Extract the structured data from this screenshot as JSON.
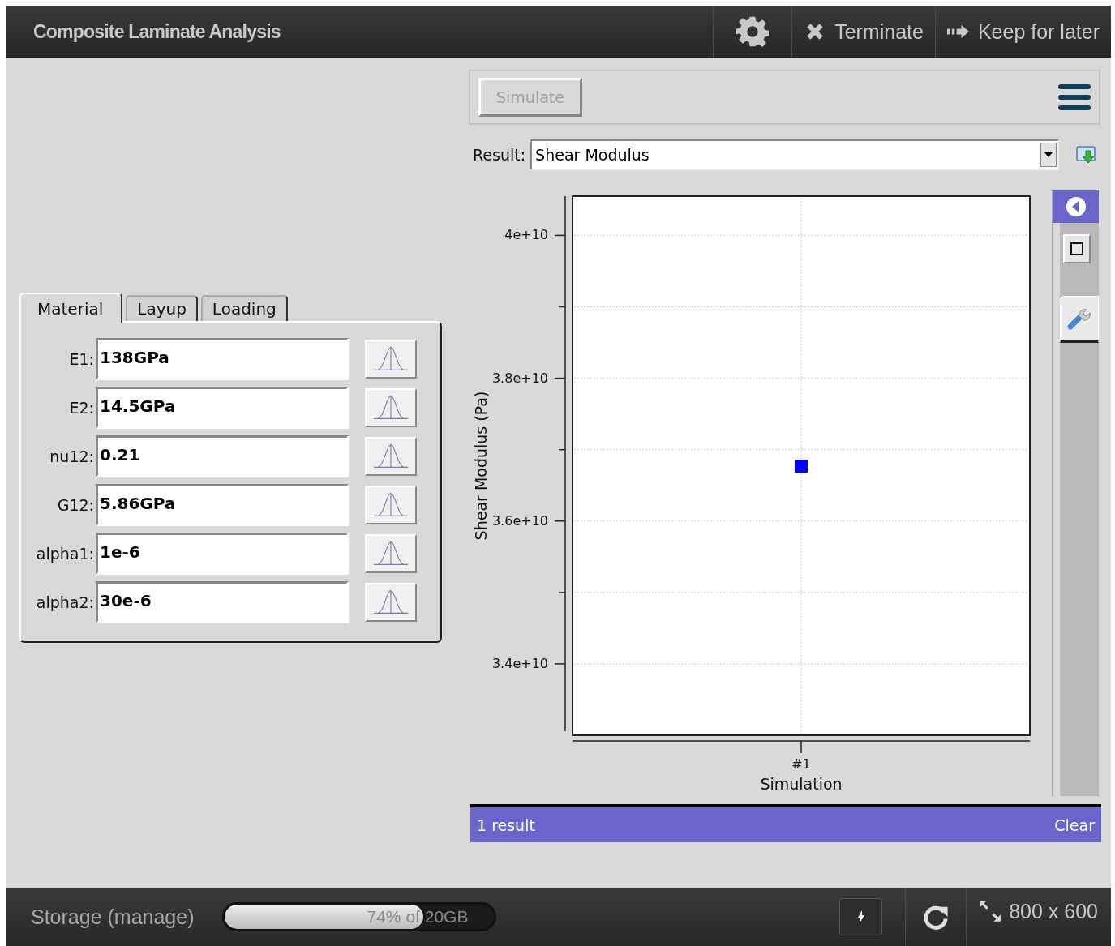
{
  "window": {
    "title": "Composite Laminate Analysis"
  },
  "header_actions": [
    {
      "kind": "settings"
    },
    {
      "kind": "terminate",
      "label": "Terminate"
    },
    {
      "kind": "keep",
      "label": "Keep for later"
    }
  ],
  "tabs": [
    {
      "label": "Material",
      "selected": true
    },
    {
      "label": "Layup",
      "selected": false
    },
    {
      "label": "Loading",
      "selected": false
    }
  ],
  "parameters": [
    {
      "label": "E1:",
      "value": "138GPa"
    },
    {
      "label": "E2:",
      "value": "14.5GPa"
    },
    {
      "label": "nu12:",
      "value": "0.21"
    },
    {
      "label": "G12:",
      "value": "5.86GPa"
    },
    {
      "label": "alpha1:",
      "value": "1e-6"
    },
    {
      "label": "alpha2:",
      "value": "30e-6"
    }
  ],
  "toolbar": {
    "simulate": {
      "label": "Simulate",
      "disabled": true
    }
  },
  "result": {
    "label": "Result:",
    "value": "Shear Modulus"
  },
  "chart_data": {
    "type": "scatter",
    "xlabel": "Simulation",
    "ylabel": "Shear Modulus (Pa)",
    "categories": [
      "#1"
    ],
    "values": [
      36770000000.0
    ],
    "ylim": [
      33000000000.0,
      40550000000.0
    ],
    "yticks": [
      {
        "value": 34000000000.0,
        "label": "3.4e+10"
      },
      {
        "value": 36000000000.0,
        "label": "3.6e+10"
      },
      {
        "value": 38000000000.0,
        "label": "3.8e+10"
      },
      {
        "value": 40000000000.0,
        "label": "4e+10"
      }
    ],
    "color": "#0000ff",
    "grid": true
  },
  "results_bar": {
    "count": "1 result",
    "clear": "Clear"
  },
  "status_bar": {
    "storage": "Storage (manage)",
    "usage": {
      "text": "74% of 20GB",
      "level": 0.74
    },
    "size": "800 x 600"
  }
}
